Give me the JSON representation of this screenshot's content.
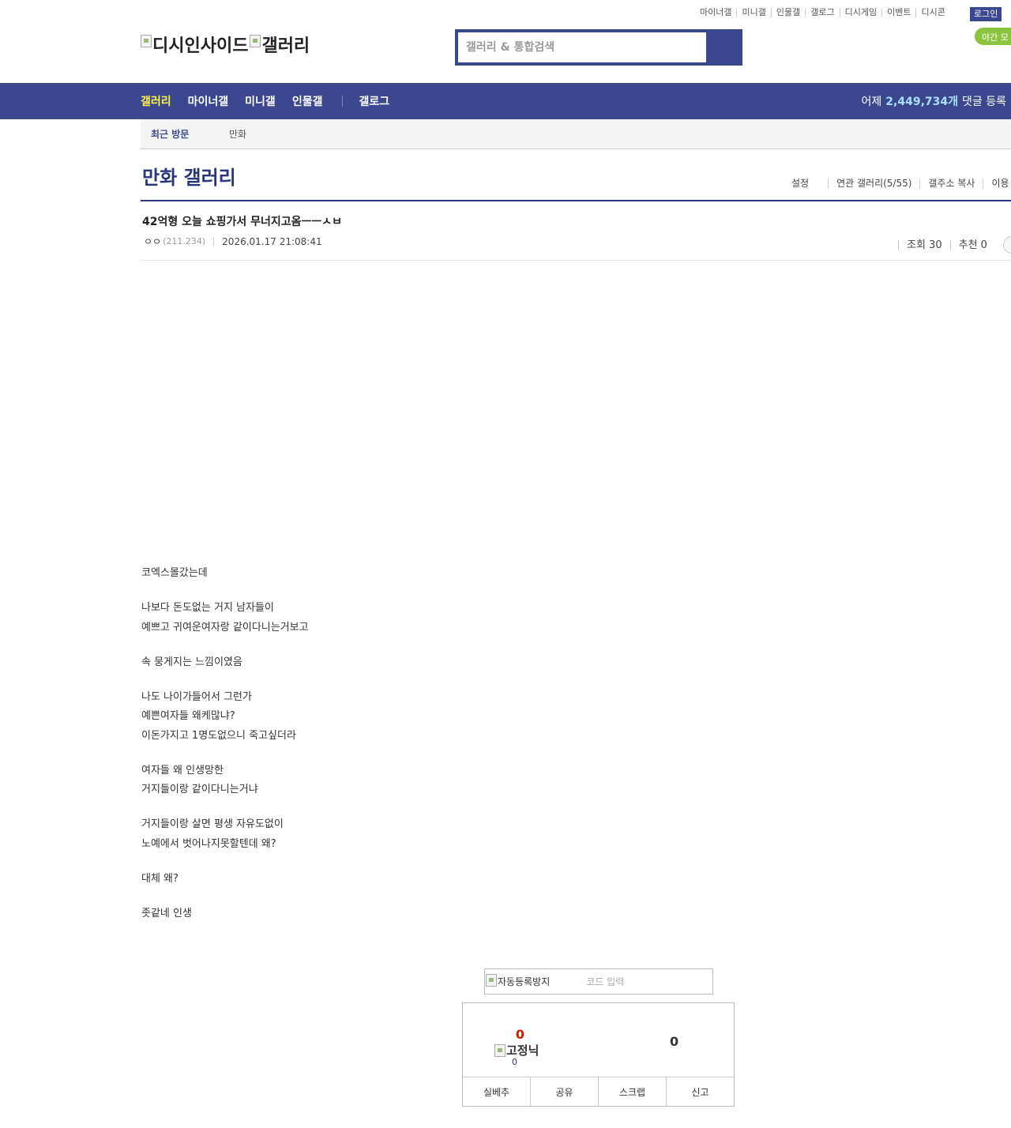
{
  "top_links": [
    "마이너갤",
    "미니갤",
    "인물갤",
    "갤로그",
    "디시게임",
    "이벤트",
    "디시콘"
  ],
  "login_label": "로그인",
  "night_mode_label": "야간 모",
  "logo": {
    "site_alt": "디시인사이드",
    "gallery_alt": "갤러리"
  },
  "search": {
    "placeholder": "갤러리 & 통합검색"
  },
  "nav": {
    "items": [
      "갤러리",
      "마이너갤",
      "미니갤",
      "인물갤"
    ],
    "gallog": "갤로그",
    "comment_prefix": "어제",
    "comment_count": "2,449,734개",
    "comment_suffix": "댓글 등록"
  },
  "recent": {
    "label": "최근 방문",
    "items": [
      "만화"
    ]
  },
  "gallery": {
    "title": "만화 갤러리",
    "menu": [
      "설정",
      "연관 갤러리(5/55)",
      "갤주소 복사",
      "이용"
    ]
  },
  "post": {
    "title": "42억형 오늘 쇼핑가서 무너지고옴ㅡㅡㅅㅂ",
    "author": "ㅇㅇ",
    "ip": "(211.234)",
    "date": "2026.01.17 21:08:41",
    "views": "조회 30",
    "recommends": "추천 0",
    "body_paragraphs": [
      [
        "코엑스몰갔는데"
      ],
      [
        "나보다 돈도없는 거지 남자들이",
        "예쁘고 귀여운여자랑 같이다니는거보고"
      ],
      [
        "속 뭉게지는 느낌이였음"
      ],
      [
        "나도 나이가들어서 그런가",
        "예쁜여자들 왜케많냐?",
        "이돈가지고 1명도없으니 죽고싶더라"
      ],
      [
        "여자들 왜 인생망한",
        "거지들이랑 같이다니는거냐"
      ],
      [
        "거지들이랑 살면 평생 자유도없이",
        "노예에서 벗어나지못할텐데 왜?"
      ],
      [
        "대체 왜?"
      ],
      [
        "좃같네 인생"
      ]
    ]
  },
  "captcha": {
    "img_alt": "자동등록방지",
    "placeholder": "코드 입력"
  },
  "recommend": {
    "up_count": "0",
    "fixed_alt": "고정닉",
    "fixed_count": "0",
    "down_count": "0",
    "actions": [
      "실베추",
      "공유",
      "스크랩",
      "신고"
    ]
  }
}
